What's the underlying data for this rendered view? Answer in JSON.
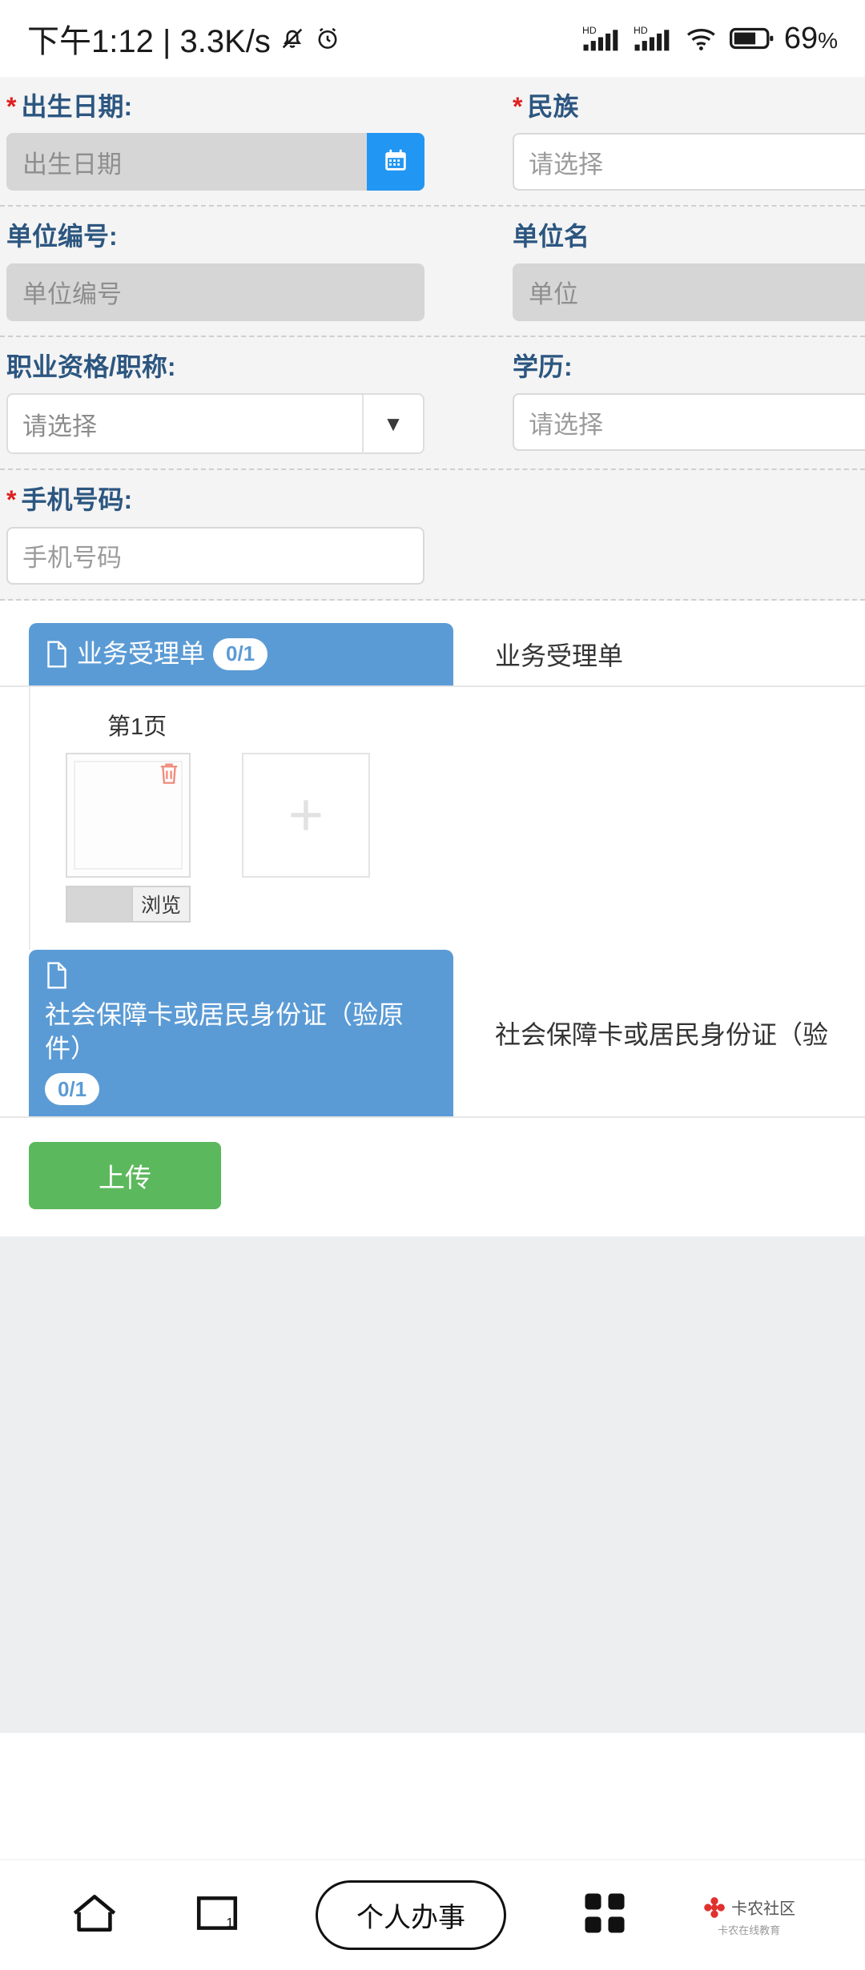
{
  "statusbar": {
    "time": "下午1:12 | 3.3K/s",
    "mute_icon": "bell-off-icon",
    "alarm_icon": "alarm-clock-icon",
    "signal1_label": "HD",
    "signal2_label": "HD",
    "wifi_icon": "wifi-icon",
    "battery_icon": "battery-icon",
    "battery_percent": "69",
    "battery_percent_unit": "%"
  },
  "form": {
    "rows": [
      {
        "left": {
          "label": "出生日期:",
          "required": true,
          "type": "date",
          "value": "",
          "placeholder": "出生日期",
          "disabled": true,
          "button_icon": "calendar-icon"
        },
        "right": {
          "label": "民族",
          "required": true,
          "type": "select",
          "value": "",
          "placeholder": "请选择"
        }
      },
      {
        "left": {
          "label": "单位编号:",
          "required": false,
          "type": "text",
          "value": "",
          "placeholder": "单位编号",
          "disabled": true
        },
        "right": {
          "label": "单位名",
          "required": false,
          "type": "text",
          "value": "",
          "placeholder": "单位",
          "disabled": true
        }
      },
      {
        "left": {
          "label": "职业资格/职称:",
          "required": false,
          "type": "select",
          "value": "",
          "placeholder": "请选择",
          "arrow": "▼"
        },
        "right": {
          "label": "学历:",
          "required": false,
          "type": "select",
          "value": "",
          "placeholder": "请选择"
        }
      },
      {
        "left": {
          "label": "手机号码:",
          "required": true,
          "type": "text",
          "value": "",
          "placeholder": "手机号码",
          "disabled": false
        },
        "right": null
      }
    ]
  },
  "attachments": {
    "sections": [
      {
        "tab_label": "业务受理单",
        "tab_icon": "document-icon",
        "count_badge": "0/1",
        "title": "业务受理单",
        "expanded": true,
        "page_label": "第1页",
        "thumbnail": {
          "delete_icon": "trash-icon",
          "file_input_value": "",
          "browse_label": "浏览"
        },
        "add_label": "+"
      },
      {
        "tab_label": "社会保障卡或居民身份证（验原件）",
        "tab_icon": "document-icon",
        "count_badge": "0/1",
        "title": "社会保障卡或居民身份证（验",
        "expanded": false
      }
    ],
    "upload_button": "上传"
  },
  "bottom_nav": {
    "items": [
      {
        "name": "home-icon",
        "label": ""
      },
      {
        "name": "recents-icon",
        "label": "1"
      },
      {
        "name": "personal-service-pill",
        "label": "个人办事"
      },
      {
        "name": "apps-grid-icon",
        "label": ""
      },
      {
        "name": "watermark",
        "label": "卡农社区",
        "sub": "卡农在线教育"
      }
    ]
  },
  "colors": {
    "accent_blue": "#2196f3",
    "tab_blue": "#5b9bd5",
    "label_blue": "#2c5680",
    "required_red": "#e02020",
    "upload_green": "#5cb85c",
    "page_bg": "#f4f4f4"
  }
}
